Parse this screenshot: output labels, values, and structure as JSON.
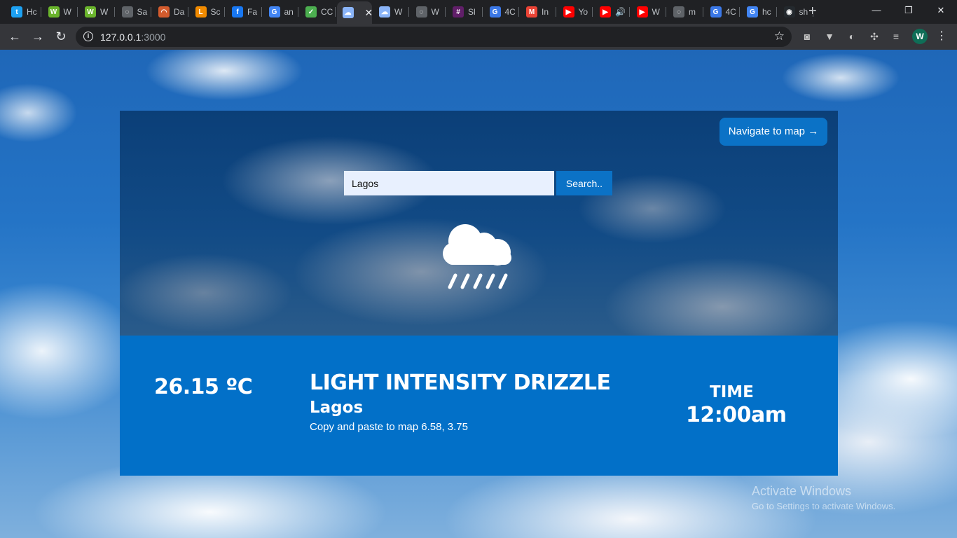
{
  "browser": {
    "tabs": [
      {
        "label": "Hc",
        "color": "#1da1f2",
        "glyph": "t"
      },
      {
        "label": "W",
        "color": "#6ab42c",
        "glyph": "W"
      },
      {
        "label": "W",
        "color": "#6ab42c",
        "glyph": "W"
      },
      {
        "label": "Sa",
        "color": "#5f6368",
        "glyph": "◌"
      },
      {
        "label": "Da",
        "color": "#d35b2d",
        "glyph": "◠"
      },
      {
        "label": "Sc",
        "color": "#f28b00",
        "glyph": "L"
      },
      {
        "label": "Fa",
        "color": "#1877f2",
        "glyph": "f"
      },
      {
        "label": "an",
        "color": "#4285f4",
        "glyph": "G"
      },
      {
        "label": "CC",
        "color": "#4caf50",
        "glyph": "✓"
      },
      {
        "label": "",
        "color": "#8ab4f8",
        "glyph": "☁"
      },
      {
        "label": "W",
        "color": "#8ab4f8",
        "glyph": "☁"
      },
      {
        "label": "W",
        "color": "#5f6368",
        "glyph": "◌"
      },
      {
        "label": "Sl",
        "color": "#611f69",
        "glyph": "#"
      },
      {
        "label": "4C",
        "color": "#3b78e7",
        "glyph": "G"
      },
      {
        "label": "In",
        "color": "#ea4335",
        "glyph": "M"
      },
      {
        "label": "Yo",
        "color": "#ff0000",
        "glyph": "▶"
      },
      {
        "label": "🔊",
        "color": "#ff0000",
        "glyph": "▶"
      },
      {
        "label": "W",
        "color": "#ff0000",
        "glyph": "▶"
      },
      {
        "label": "m",
        "color": "#5f6368",
        "glyph": "◌"
      },
      {
        "label": "4C",
        "color": "#3b78e7",
        "glyph": "G"
      },
      {
        "label": "hc",
        "color": "#4285f4",
        "glyph": "G"
      },
      {
        "label": "sh",
        "color": "#24292e",
        "glyph": "◉"
      }
    ],
    "new_tab": "+",
    "window_controls": {
      "minimize": "—",
      "restore": "❐",
      "close": "✕"
    },
    "url_host": "127.0.0.1",
    "url_port": ":3000"
  },
  "app": {
    "navigate_button": "Navigate to map →",
    "search": {
      "value": "Lagos",
      "button_label": "Search.."
    },
    "weather_icon": "rain-cloud-icon",
    "temperature": "26.15 ºC",
    "description": "LIGHT INTENSITY DRIZZLE",
    "city": "Lagos",
    "coords_text": "Copy and paste to map 6.58, 3.75",
    "time_label": "TIME",
    "time_value": "12:00am"
  },
  "watermark": {
    "title": "Activate Windows",
    "subtitle": "Go to Settings to activate Windows."
  }
}
